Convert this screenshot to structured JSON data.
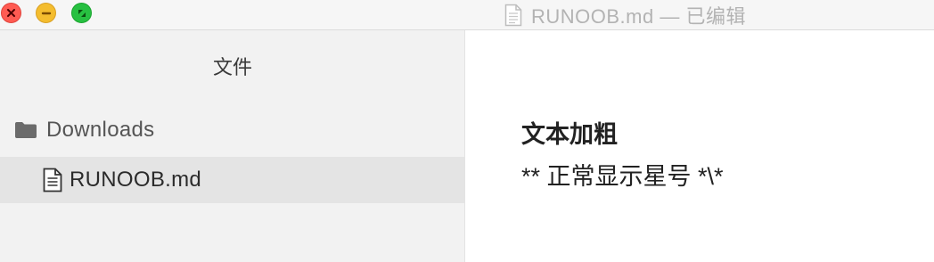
{
  "window": {
    "title": "RUNOOB.md — 已编辑"
  },
  "sidebar": {
    "header": "文件",
    "folder": {
      "label": "Downloads",
      "icon": "folder-icon"
    },
    "file": {
      "label": "RUNOOB.md",
      "icon": "document-icon",
      "selected": true
    }
  },
  "content": {
    "bold_line": "文本加粗",
    "plain_line": "** 正常显示星号 *\\*"
  },
  "colors": {
    "close": "#ff5b52",
    "minimize": "#f4bd2f",
    "zoom": "#27c041",
    "sidebar_bg": "#f2f2f2",
    "selected_row": "#e4e4e4"
  }
}
